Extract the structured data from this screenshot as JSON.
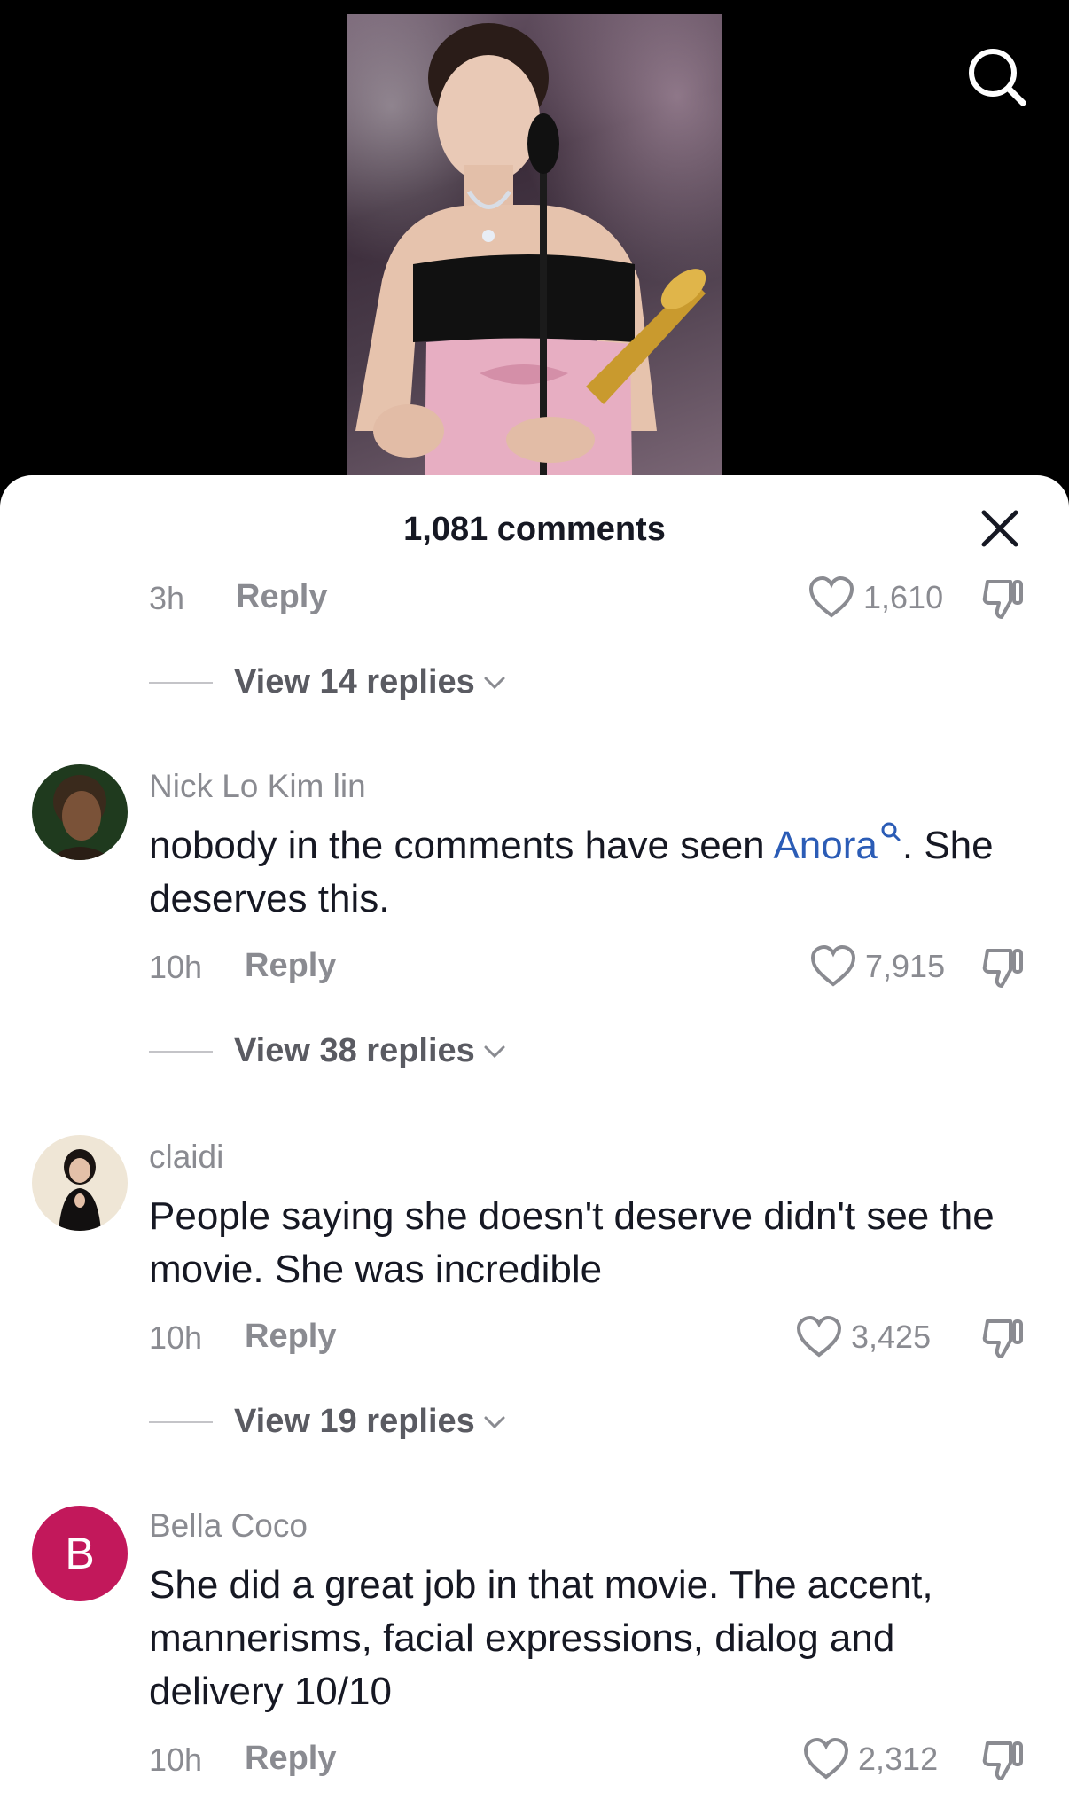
{
  "header": {
    "comments_count": "1,081 comments"
  },
  "comments": [
    {
      "time": "3h",
      "reply_label": "Reply",
      "likes": "1,610",
      "view_replies": "View 14 replies"
    },
    {
      "username": "Nick Lo Kim lin",
      "text_before": "nobody in the comments have seen ",
      "mention": "Anora",
      "text_after": ". She deserves this.",
      "time": "10h",
      "reply_label": "Reply",
      "likes": "7,915",
      "view_replies": "View 38 replies"
    },
    {
      "username": "claidi",
      "text": "People saying she doesn't deserve didn't see the movie. She was incredible",
      "time": "10h",
      "reply_label": "Reply",
      "likes": "3,425",
      "view_replies": "View 19 replies"
    },
    {
      "username": "Bella Coco",
      "avatar_letter": "B",
      "text": "She did a great job in that movie. The accent, mannerisms, facial expressions, dialog and delivery 10/10",
      "time": "10h",
      "reply_label": "Reply",
      "likes": "2,312"
    }
  ],
  "colors": {
    "avatar_b": "#c2185b",
    "mention": "#2b5cb6",
    "muted": "#8a8b91"
  },
  "icons": [
    "search-icon",
    "close-icon",
    "heart-icon",
    "dislike-icon",
    "chevron-down-icon",
    "mention-search-icon"
  ]
}
